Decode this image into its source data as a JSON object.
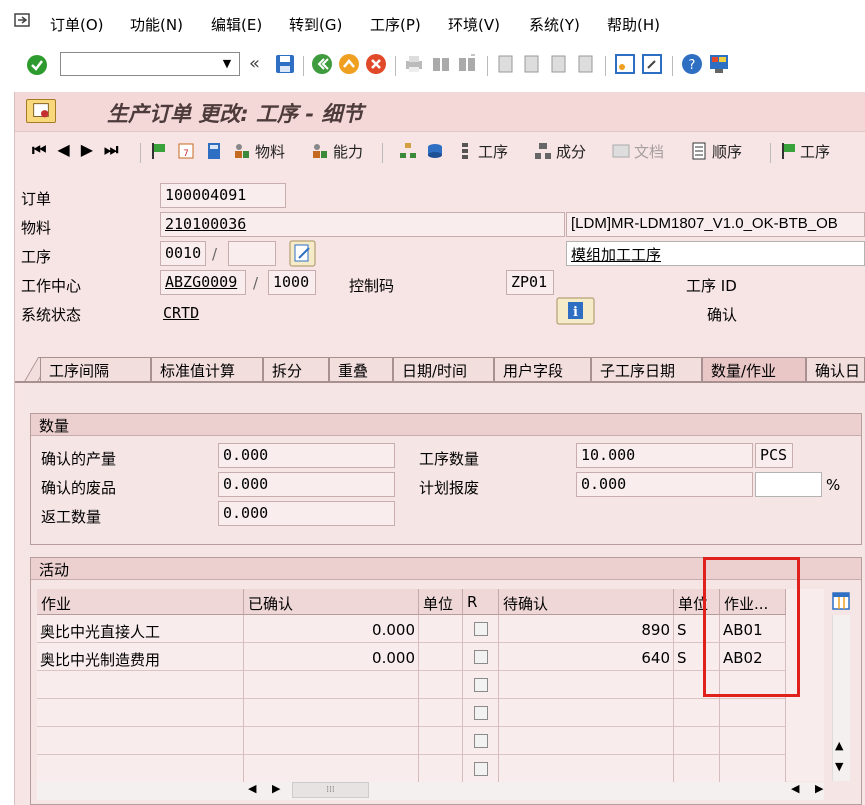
{
  "menubar": {
    "items": [
      "订单(O)",
      "功能(N)",
      "编辑(E)",
      "转到(G)",
      "工序(P)",
      "环境(V)",
      "系统(Y)",
      "帮助(H)"
    ]
  },
  "toolbar": {
    "command_value": "",
    "icons": [
      "enter-icon",
      "save-icon",
      "back-icon",
      "exit-icon",
      "cancel-icon",
      "print-icon",
      "find-icon",
      "find-next-icon",
      "first-page-icon",
      "prev-page-icon",
      "next-page-icon",
      "last-page-icon",
      "create-session-icon",
      "shortcut-icon",
      "help-icon",
      "customize-icon"
    ]
  },
  "title": "生产订单 更改: 工序 - 细节",
  "app_toolbar": {
    "material_btn": "物料",
    "capacity_btn": "能力",
    "operation_btn": "工序",
    "component_btn": "成分",
    "document_btn": "文档",
    "sequence_btn": "顺序",
    "operation_btn2": "工序"
  },
  "header": {
    "order_label": "订单",
    "order_value": "100004091",
    "material_label": "物料",
    "material_value": "210100036",
    "material_desc": "[LDM]MR-LDM1807_V1.0_OK-BTB_OB",
    "operation_label": "工序",
    "operation_value": "0010",
    "operation_sep": "/",
    "suboperation_value": "",
    "operation_desc": "模组加工工序",
    "workcenter_label": "工作中心",
    "workcenter_value": "ABZG0009",
    "plant_sep": "/",
    "plant_value": "1000",
    "control_key_label": "控制码",
    "control_key_value": "ZP01",
    "operation_id_label": "工序 ID",
    "system_status_label": "系统状态",
    "system_status_value": "CRTD",
    "confirm_label": "确认"
  },
  "tabs": [
    "工序间隔",
    "标准值计算",
    "拆分",
    "重叠",
    "日期/时间",
    "用户字段",
    "子工序日期",
    "数量/作业",
    "确认日"
  ],
  "active_tab": "数量/作业",
  "quantities": {
    "group_title": "数量",
    "confirmed_yield_label": "确认的产量",
    "confirmed_yield_value": "0.000",
    "confirmed_scrap_label": "确认的废品",
    "confirmed_scrap_value": "0.000",
    "rework_label": "返工数量",
    "rework_value": "0.000",
    "op_qty_label": "工序数量",
    "op_qty_value": "10.000",
    "op_qty_unit": "PCS",
    "planned_scrap_label": "计划报废",
    "planned_scrap_value": "0.000",
    "planned_scrap_pct_value": "",
    "pct_sign": "%"
  },
  "activities": {
    "group_title": "活动",
    "columns": [
      "作业",
      "已确认",
      "单位",
      "R",
      "待确认",
      "单位",
      "作业..."
    ],
    "rows": [
      {
        "activity": "奥比中光直接人工",
        "confirmed": "0.000",
        "unit": "",
        "r": false,
        "to_confirm": "890",
        "unit2": "S",
        "type": "AB01"
      },
      {
        "activity": "奥比中光制造费用",
        "confirmed": "0.000",
        "unit": "",
        "r": false,
        "to_confirm": "640",
        "unit2": "S",
        "type": "AB02"
      }
    ]
  },
  "colors": {
    "frame_bg": "#f7e4e4",
    "highlight_box": "#e0201c"
  }
}
